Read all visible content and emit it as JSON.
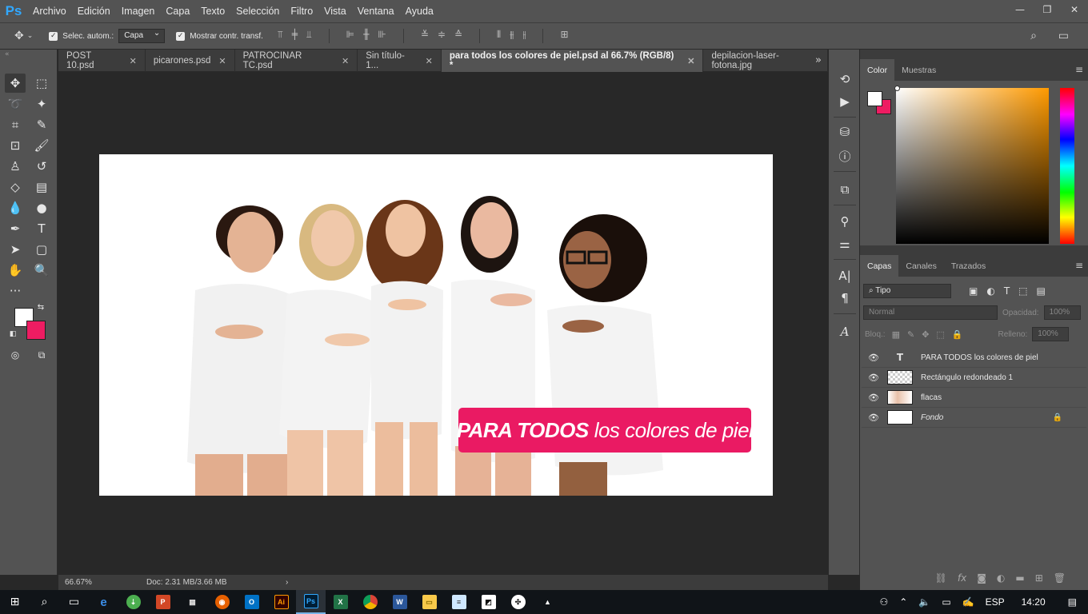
{
  "app": {
    "logo": "Ps"
  },
  "menu": [
    "Archivo",
    "Edición",
    "Imagen",
    "Capa",
    "Texto",
    "Selección",
    "Filtro",
    "Vista",
    "Ventana",
    "Ayuda"
  ],
  "options": {
    "auto_select_label": "Selec. autom.:",
    "auto_select_value": "Capa",
    "transform_label": "Mostrar contr. transf."
  },
  "tabs": [
    {
      "label": "POST 10.psd",
      "active": false
    },
    {
      "label": "picarones.psd",
      "active": false
    },
    {
      "label": "PATROCINAR TC.psd",
      "active": false
    },
    {
      "label": "Sin título-1...",
      "active": false
    },
    {
      "label": "para todos los colores de piel.psd al 66.7% (RGB/8) *",
      "active": true
    },
    {
      "label": "depilacion-laser-fotona.jpg",
      "active": false
    }
  ],
  "document": {
    "banner_bold": "PARA TODOS",
    "banner_rest": "los colores de piel"
  },
  "status": {
    "zoom": "66.67%",
    "doc_info": "Doc: 2.31 MB/3.66 MB",
    "arrow": "›"
  },
  "color_panel": {
    "tabs": [
      "Color",
      "Muestras"
    ],
    "fg_color": "#ffffff",
    "bg_color": "#ee1c62"
  },
  "layers_panel": {
    "tabs": [
      "Capas",
      "Canales",
      "Trazados"
    ],
    "filter_label": "Tipo",
    "blend_mode": "Normal",
    "opacity_label": "Opacidad:",
    "opacity_value": "100%",
    "lock_label": "Bloq.:",
    "fill_label": "Relleno:",
    "fill_value": "100%",
    "layers": [
      {
        "name": "PARA TODOS los colores de piel",
        "type": "text",
        "thumb": "T"
      },
      {
        "name": "Rectángulo redondeado 1",
        "type": "shape"
      },
      {
        "name": "flacas",
        "type": "image"
      },
      {
        "name": "Fondo",
        "type": "background",
        "locked": true
      }
    ]
  },
  "taskbar": {
    "language": "ESP",
    "time": "14:20"
  }
}
